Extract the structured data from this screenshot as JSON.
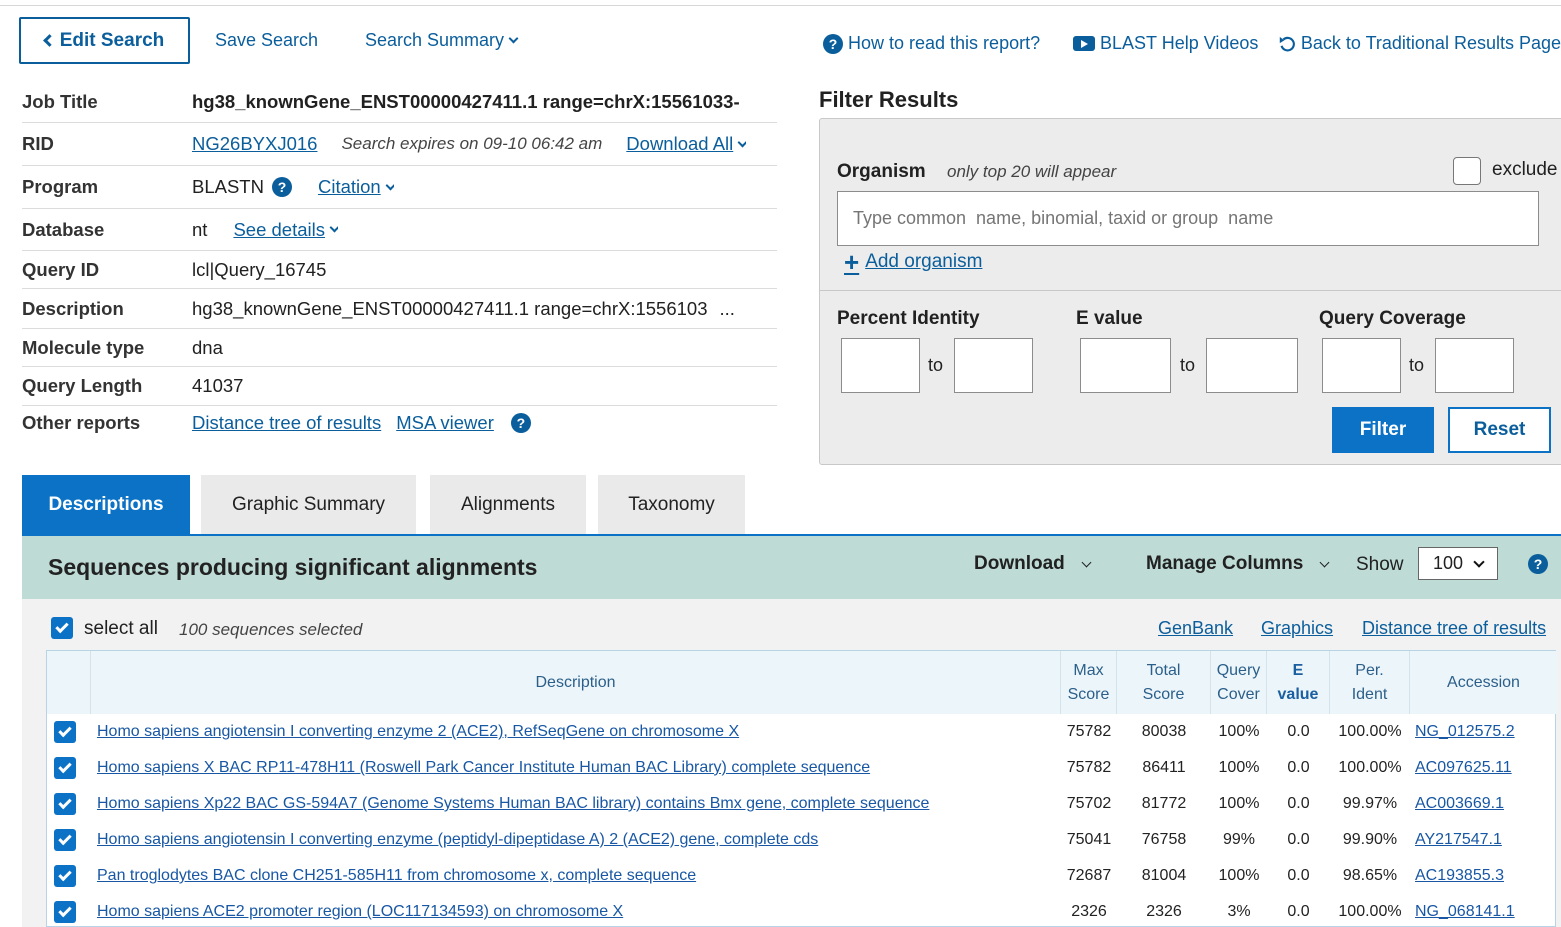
{
  "topbar": {
    "edit_search": "Edit Search",
    "save_search": "Save Search",
    "search_summary": "Search Summary",
    "how_to_read": "How to read this report?",
    "help_videos": "BLAST Help Videos",
    "back_traditional": "Back to Traditional Results Page"
  },
  "summary": {
    "job_title": {
      "label": "Job Title",
      "value": "hg38_knownGene_ENST00000427411.1 range=chrX:15561033-"
    },
    "rid": {
      "label": "RID",
      "value": "NG26BYXJ016",
      "expires": "Search expires on 09-10 06:42 am",
      "download_all": "Download All"
    },
    "program": {
      "label": "Program",
      "value": "BLASTN",
      "citation": "Citation"
    },
    "database": {
      "label": "Database",
      "value": "nt",
      "see_details": "See details"
    },
    "query_id": {
      "label": "Query ID",
      "value": "lcl|Query_16745"
    },
    "description": {
      "label": "Description",
      "value": "hg38_knownGene_ENST00000427411.1 range=chrX:1556103",
      "ellipsis": "..."
    },
    "molecule_type": {
      "label": "Molecule type",
      "value": "dna"
    },
    "query_length": {
      "label": "Query Length",
      "value": "41037"
    },
    "other_reports": {
      "label": "Other reports",
      "distance_tree": "Distance tree of results",
      "msa_viewer": "MSA viewer"
    }
  },
  "filter": {
    "title": "Filter Results",
    "organism_label": "Organism",
    "organism_hint": "only top 20 will appear",
    "exclude": "exclude",
    "organism_placeholder": "Type common  name, binomial, taxid or group  name",
    "add_organism": "Add organism",
    "percent_identity": "Percent Identity",
    "e_value": "E value",
    "query_coverage": "Query Coverage",
    "to": "to",
    "filter_btn": "Filter",
    "reset_btn": "Reset"
  },
  "tabs": {
    "descriptions": "Descriptions",
    "graphic_summary": "Graphic Summary",
    "alignments": "Alignments",
    "taxonomy": "Taxonomy"
  },
  "results": {
    "heading": "Sequences producing significant alignments",
    "download": "Download",
    "manage_columns": "Manage Columns",
    "show": "Show",
    "show_value": "100",
    "select_all": "select all",
    "selected_count": "100 sequences selected",
    "genbank": "GenBank",
    "graphics": "Graphics",
    "distance_tree": "Distance tree of results",
    "columns": {
      "description": "Description",
      "max_score_1": "Max",
      "max_score_2": "Score",
      "total_score_1": "Total",
      "total_score_2": "Score",
      "query_cover_1": "Query",
      "query_cover_2": "Cover",
      "e_value_1": "E",
      "e_value_2": "value",
      "per_ident_1": "Per.",
      "per_ident_2": "Ident",
      "accession": "Accession"
    },
    "rows": [
      {
        "description": "Homo sapiens angiotensin I converting enzyme 2 (ACE2), RefSeqGene on chromosome X",
        "max": "75782",
        "total": "80038",
        "cover": "100%",
        "e": "0.0",
        "ident": "100.00%",
        "acc": "NG_012575.2"
      },
      {
        "description": "Homo sapiens X BAC RP11-478H11 (Roswell Park Cancer Institute Human BAC Library) complete sequence",
        "max": "75782",
        "total": "86411",
        "cover": "100%",
        "e": "0.0",
        "ident": "100.00%",
        "acc": "AC097625.11"
      },
      {
        "description": "Homo sapiens Xp22 BAC GS-594A7 (Genome Systems Human BAC library) contains Bmx gene, complete sequence",
        "max": "75702",
        "total": "81772",
        "cover": "100%",
        "e": "0.0",
        "ident": "99.97%",
        "acc": "AC003669.1"
      },
      {
        "description": "Homo sapiens angiotensin I converting enzyme (peptidyl-dipeptidase A) 2 (ACE2) gene, complete cds",
        "max": "75041",
        "total": "76758",
        "cover": "99%",
        "e": "0.0",
        "ident": "99.90%",
        "acc": "AY217547.1"
      },
      {
        "description": "Pan troglodytes BAC clone CH251-585H11 from chromosome x, complete sequence",
        "max": "72687",
        "total": "81004",
        "cover": "100%",
        "e": "0.0",
        "ident": "98.65%",
        "acc": "AC193855.3"
      },
      {
        "description": "Homo sapiens ACE2 promoter region (LOC117134593) on chromosome X",
        "max": "2326",
        "total": "2326",
        "cover": "3%",
        "e": "0.0",
        "ident": "100.00%",
        "acc": "NG_068141.1"
      }
    ]
  }
}
